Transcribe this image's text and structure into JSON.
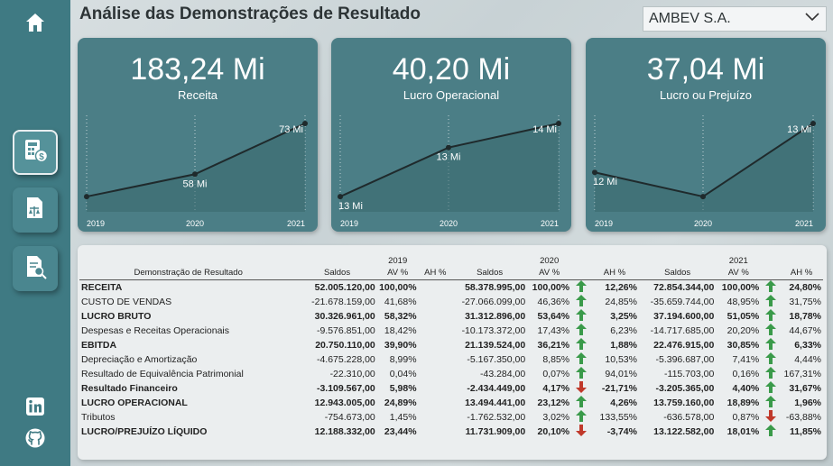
{
  "page": {
    "title": "Análise das Demonstrações de Resultado",
    "company": "AMBEV S.A."
  },
  "colors": {
    "sidebar": "#3f7a83",
    "card": "#4b7e86",
    "up": "#3a9a4a",
    "down": "#c0392b"
  },
  "sidebar": {
    "icons": [
      "home-icon",
      "finance-calculator-icon",
      "balance-sheet-icon",
      "document-search-icon",
      "linkedin-icon",
      "github-icon"
    ]
  },
  "cards": [
    {
      "value": "183,24 Mi",
      "label": "Receita",
      "chart_data": {
        "type": "line",
        "x": [
          "2019",
          "2020",
          "2021"
        ],
        "values": [
          52.0,
          58.38,
          72.85
        ],
        "data_labels": [
          "",
          "58 Mi",
          "73 Mi"
        ]
      }
    },
    {
      "value": "40,20 Mi",
      "label": "Lucro Operacional",
      "chart_data": {
        "type": "line",
        "x": [
          "2019",
          "2020",
          "2021"
        ],
        "values": [
          12.94,
          13.49,
          13.76
        ],
        "data_labels": [
          "13 Mi",
          "13 Mi",
          "14 Mi"
        ]
      }
    },
    {
      "value": "37,04 Mi",
      "label": "Lucro ou Prejuízo",
      "chart_data": {
        "type": "line",
        "x": [
          "2019",
          "2020",
          "2021"
        ],
        "values": [
          12.19,
          11.73,
          13.12
        ],
        "data_labels": [
          "12 Mi",
          "",
          "13 Mi"
        ]
      }
    }
  ],
  "table": {
    "header_label": "Demonstração de Resultado",
    "years": [
      "2019",
      "2020",
      "2021"
    ],
    "cols": {
      "saldos": "Saldos",
      "av": "AV %",
      "ah": "AH %"
    },
    "rows": [
      {
        "label": "RECEITA",
        "bold": true,
        "y1": [
          "52.005.120,00",
          "100,00%",
          ""
        ],
        "y2": [
          "58.378.995,00",
          "100,00%",
          "up",
          "12,26%"
        ],
        "y3": [
          "72.854.344,00",
          "100,00%",
          "up",
          "24,80%"
        ]
      },
      {
        "label": "CUSTO DE VENDAS",
        "bold": false,
        "y1": [
          "-21.678.159,00",
          "41,68%",
          ""
        ],
        "y2": [
          "-27.066.099,00",
          "46,36%",
          "up",
          "24,85%"
        ],
        "y3": [
          "-35.659.744,00",
          "48,95%",
          "up",
          "31,75%"
        ]
      },
      {
        "label": "LUCRO BRUTO",
        "bold": true,
        "y1": [
          "30.326.961,00",
          "58,32%",
          ""
        ],
        "y2": [
          "31.312.896,00",
          "53,64%",
          "up",
          "3,25%"
        ],
        "y3": [
          "37.194.600,00",
          "51,05%",
          "up",
          "18,78%"
        ]
      },
      {
        "label": "Despesas e Receitas Operacionais",
        "bold": false,
        "y1": [
          "-9.576.851,00",
          "18,42%",
          ""
        ],
        "y2": [
          "-10.173.372,00",
          "17,43%",
          "up",
          "6,23%"
        ],
        "y3": [
          "-14.717.685,00",
          "20,20%",
          "up",
          "44,67%"
        ]
      },
      {
        "label": "EBITDA",
        "bold": true,
        "y1": [
          "20.750.110,00",
          "39,90%",
          ""
        ],
        "y2": [
          "21.139.524,00",
          "36,21%",
          "up",
          "1,88%"
        ],
        "y3": [
          "22.476.915,00",
          "30,85%",
          "up",
          "6,33%"
        ]
      },
      {
        "label": "Depreciação e Amortização",
        "bold": false,
        "y1": [
          "-4.675.228,00",
          "8,99%",
          ""
        ],
        "y2": [
          "-5.167.350,00",
          "8,85%",
          "up",
          "10,53%"
        ],
        "y3": [
          "-5.396.687,00",
          "7,41%",
          "up",
          "4,44%"
        ]
      },
      {
        "label": "Resultado de Equivalência Patrimonial",
        "bold": false,
        "y1": [
          "-22.310,00",
          "0,04%",
          ""
        ],
        "y2": [
          "-43.284,00",
          "0,07%",
          "up",
          "94,01%"
        ],
        "y3": [
          "-115.703,00",
          "0,16%",
          "up",
          "167,31%"
        ]
      },
      {
        "label": "Resultado Financeiro",
        "bold": true,
        "y1": [
          "-3.109.567,00",
          "5,98%",
          ""
        ],
        "y2": [
          "-2.434.449,00",
          "4,17%",
          "down",
          "-21,71%"
        ],
        "y3": [
          "-3.205.365,00",
          "4,40%",
          "up",
          "31,67%"
        ]
      },
      {
        "label": "LUCRO OPERACIONAL",
        "bold": true,
        "y1": [
          "12.943.005,00",
          "24,89%",
          ""
        ],
        "y2": [
          "13.494.441,00",
          "23,12%",
          "up",
          "4,26%"
        ],
        "y3": [
          "13.759.160,00",
          "18,89%",
          "up",
          "1,96%"
        ]
      },
      {
        "label": "Tributos",
        "bold": false,
        "y1": [
          "-754.673,00",
          "1,45%",
          ""
        ],
        "y2": [
          "-1.762.532,00",
          "3,02%",
          "up",
          "133,55%"
        ],
        "y3": [
          "-636.578,00",
          "0,87%",
          "down",
          "-63,88%"
        ]
      },
      {
        "label": "LUCRO/PREJUÍZO LÍQUIDO",
        "bold": true,
        "y1": [
          "12.188.332,00",
          "23,44%",
          ""
        ],
        "y2": [
          "11.731.909,00",
          "20,10%",
          "down",
          "-3,74%"
        ],
        "y3": [
          "13.122.582,00",
          "18,01%",
          "up",
          "11,85%"
        ]
      }
    ]
  }
}
